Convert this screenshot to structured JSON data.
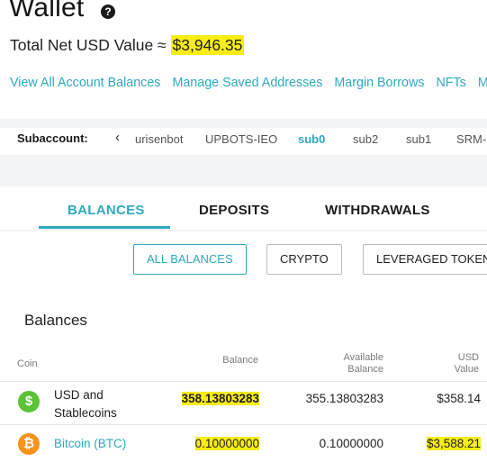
{
  "header": {
    "title": "Wallet",
    "help_icon": "?",
    "net_prefix": "Total Net USD Value ≈ ",
    "net_value": "$3,946.35",
    "links": [
      "View All Account Balances",
      "Manage Saved Addresses",
      "Margin Borrows",
      "NFTs",
      "Mis"
    ]
  },
  "subaccount": {
    "label": "Subaccount:",
    "prev_icon": "‹",
    "items": [
      "urisenbot",
      "UPBOTS-IEO",
      "sub0",
      "sub2",
      "sub1",
      "SRM-l"
    ],
    "active": "sub0"
  },
  "tabs": [
    "BALANCES",
    "DEPOSITS",
    "WITHDRAWALS"
  ],
  "filters": [
    "ALL BALANCES",
    "CRYPTO",
    "LEVERAGED TOKENS"
  ],
  "section_title": "Balances",
  "table": {
    "columns": {
      "coin": "Coin",
      "balance": "Balance",
      "available_1": "Available",
      "available_2": "Balance",
      "usd_1": "USD",
      "usd_2": "Value"
    },
    "rows": [
      {
        "icon": "dollar-icon",
        "icon_glyph": "$",
        "icon_color": "#5bc236",
        "name_1": "USD and",
        "name_2": "Stablecoins",
        "balance": "358.13803283",
        "available": "355.13803283",
        "usd": "$358.14"
      },
      {
        "icon": "bitcoin-icon",
        "icon_glyph": "₿",
        "icon_color": "#f7931a",
        "name_1": "Bitcoin (BTC)",
        "balance": "0.10000000",
        "available": "0.10000000",
        "usd": "$3,588.21"
      }
    ]
  },
  "colors": {
    "accent": "#2ea8bf",
    "highlight": "#f7ec14"
  }
}
